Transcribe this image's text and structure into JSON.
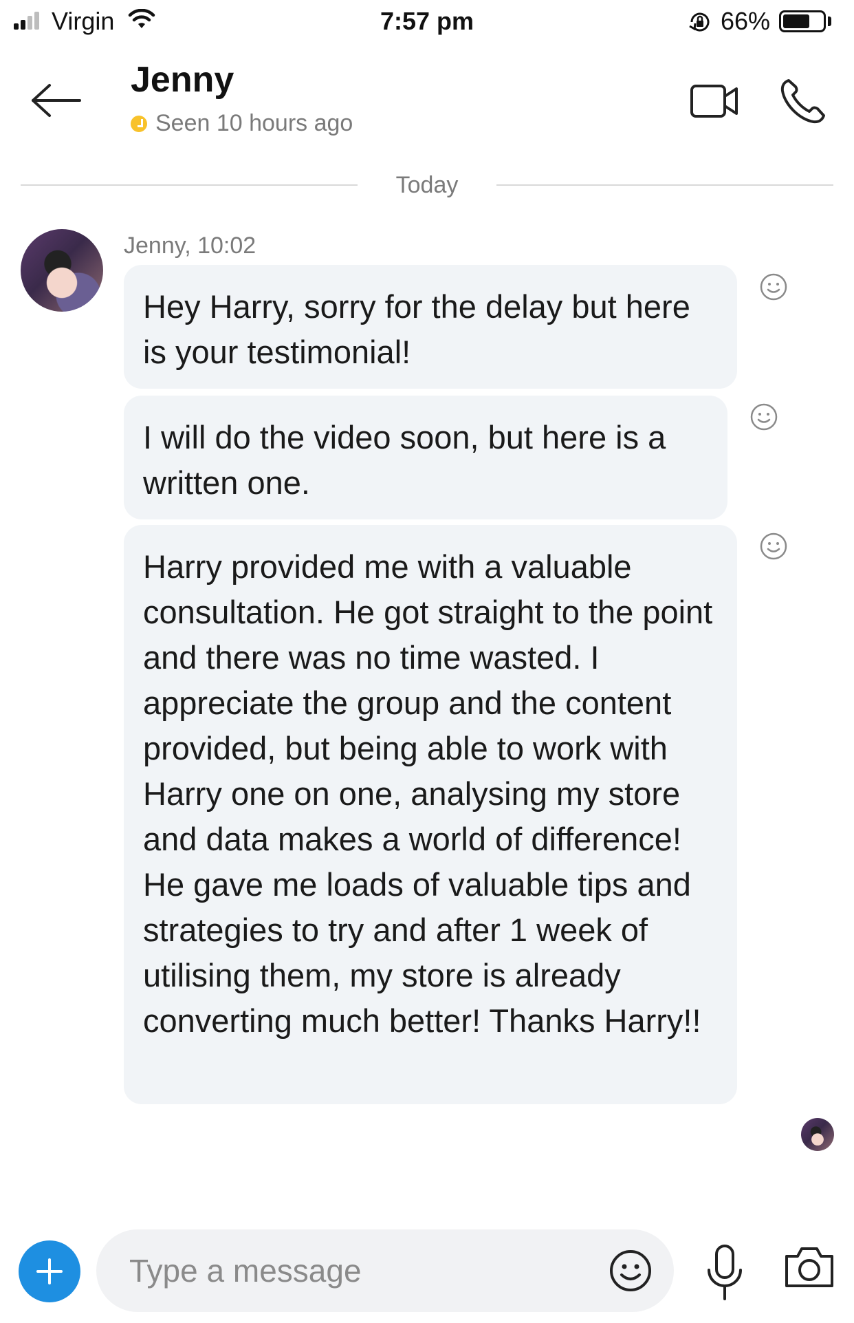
{
  "status_bar": {
    "carrier": "Virgin",
    "time": "7:57 pm",
    "battery_percent": "66%",
    "battery_level": 0.66,
    "signal_bars": 4,
    "signal_active": 2
  },
  "header": {
    "contact_name": "Jenny",
    "presence": "Seen 10 hours ago",
    "presence_color": "#f8c22b",
    "icons": [
      "back-arrow-icon",
      "video-call-icon",
      "phone-icon"
    ]
  },
  "divider": {
    "label": "Today"
  },
  "conversation": {
    "sender_line": "Jenny, 10:02",
    "messages": [
      {
        "text": "Hey Harry, sorry for the delay but here is your testimonial!"
      },
      {
        "text": "I will do the video soon, but here is a written one."
      },
      {
        "text": "Harry provided me with a valuable consultation. He got straight to the point and there was no time wasted. I appreciate the group and the content provided, but being able to work with Harry one on one, analysing my store and data makes a world of difference! He gave me loads of valuable tips and strategies to try and after 1 week of utilising them, my store is already converting much better! Thanks Harry!!"
      }
    ],
    "bubble_color": "#f1f4f7"
  },
  "composer": {
    "placeholder": "Type a message",
    "accent": "#1e8fe1",
    "icons": [
      "add-icon",
      "emoji-icon",
      "microphone-icon",
      "camera-icon"
    ]
  }
}
